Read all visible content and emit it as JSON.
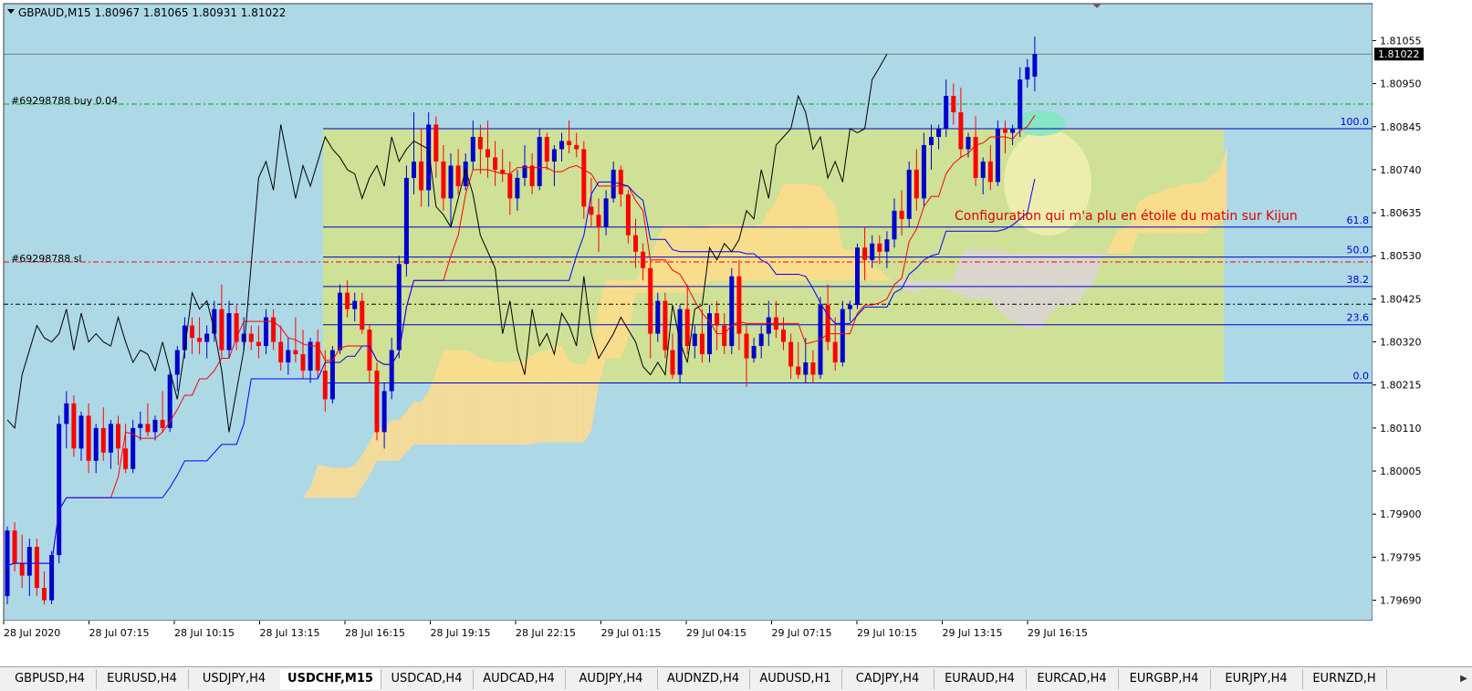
{
  "header": {
    "title": "GBPAUD,M15  1.80967 1.81065 1.80931 1.81022"
  },
  "order_labels": {
    "buy": "#69298788 buy 0.04",
    "sl": "#69298788 sl"
  },
  "annotation": "Configuration qui m'a plu en étoile du matin sur Kijun",
  "fibonacci": [
    {
      "label": "100.0",
      "price": 1.8084
    },
    {
      "label": "61.8",
      "price": 1.806
    },
    {
      "label": "50.0",
      "price": 1.80527
    },
    {
      "label": "38.2",
      "price": 1.80455
    },
    {
      "label": "23.6",
      "price": 1.80362
    },
    {
      "label": "0.0",
      "price": 1.8022
    }
  ],
  "colors": {
    "background": "#add8e6",
    "bull_candle": "#0000cd",
    "bear_candle": "#ff0000",
    "fib_line": "#0000cd",
    "fib_zone": "#d1e28d",
    "kumo_bull": "#ffdc8c",
    "kumo_bear": "#dcd2d7",
    "tenkan": "#ff0000",
    "kijun": "#0000ff",
    "chikou": "#000000",
    "cloud_cyan": "#9cdcf0",
    "highlight_green": "#80e8c0",
    "order_buy_line": "#00aa00",
    "order_sl_line": "#ff0000",
    "annotation_text": "#e00000"
  },
  "chart_data": {
    "type": "candlestick",
    "symbol": "GBPAUD",
    "timeframe": "M15",
    "ohlc": {
      "open": 1.80967,
      "high": 1.81065,
      "low": 1.80931,
      "close": 1.81022
    },
    "current_price_label": "1.81022",
    "current_price": 1.81022,
    "y_range": [
      1.7964,
      1.81145
    ],
    "y_ticks": [
      "1.81055",
      "1.80950",
      "1.80845",
      "1.80740",
      "1.80635",
      "1.80530",
      "1.80425",
      "1.80320",
      "1.80215",
      "1.80110",
      "1.80005",
      "1.79900",
      "1.79795",
      "1.79690"
    ],
    "x_ticks": [
      "28 Jul 2020",
      "28 Jul 07:15",
      "28 Jul 10:15",
      "28 Jul 13:15",
      "28 Jul 16:15",
      "28 Jul 19:15",
      "28 Jul 22:15",
      "29 Jul 01:15",
      "29 Jul 04:15",
      "29 Jul 07:15",
      "29 Jul 10:15",
      "29 Jul 13:15",
      "29 Jul 16:15"
    ],
    "order_lines": [
      {
        "name": "buy",
        "price": 1.809
      },
      {
        "name": "sl",
        "price": 1.80515
      }
    ],
    "bid_line": 1.80412,
    "candles": [
      [
        1.797,
        1.7987,
        1.7968,
        1.7986
      ],
      [
        1.7986,
        1.7988,
        1.7976,
        1.7978
      ],
      [
        1.7978,
        1.7985,
        1.7972,
        1.7975
      ],
      [
        1.7975,
        1.7984,
        1.797,
        1.7982
      ],
      [
        1.7982,
        1.7984,
        1.797,
        1.7972
      ],
      [
        1.7972,
        1.7976,
        1.7968,
        1.7969
      ],
      [
        1.7969,
        1.7981,
        1.7968,
        1.798
      ],
      [
        1.798,
        1.8014,
        1.7978,
        1.8012
      ],
      [
        1.8012,
        1.802,
        1.8006,
        1.8017
      ],
      [
        1.8017,
        1.8019,
        1.8004,
        1.8006
      ],
      [
        1.8006,
        1.8015,
        1.8003,
        1.8014
      ],
      [
        1.8014,
        1.8017,
        1.8,
        1.8003
      ],
      [
        1.8003,
        1.8012,
        1.8,
        1.8011
      ],
      [
        1.8011,
        1.8016,
        1.8003,
        1.8005
      ],
      [
        1.8005,
        1.8013,
        1.8001,
        1.8012
      ],
      [
        1.8012,
        1.8014,
        1.8002,
        1.8006
      ],
      [
        1.8006,
        1.8012,
        1.8,
        1.8001
      ],
      [
        1.8001,
        1.8013,
        1.8,
        1.8011
      ],
      [
        1.8011,
        1.8015,
        1.8008,
        1.8012
      ],
      [
        1.8012,
        1.8017,
        1.8009,
        1.801
      ],
      [
        1.801,
        1.8014,
        1.8008,
        1.8013
      ],
      [
        1.8013,
        1.802,
        1.801,
        1.8011
      ],
      [
        1.8011,
        1.8025,
        1.801,
        1.8024
      ],
      [
        1.8024,
        1.8031,
        1.802,
        1.803
      ],
      [
        1.803,
        1.8038,
        1.8028,
        1.8036
      ],
      [
        1.8036,
        1.8038,
        1.8029,
        1.8033
      ],
      [
        1.8033,
        1.8038,
        1.8029,
        1.8032
      ],
      [
        1.8032,
        1.8036,
        1.8028,
        1.8034
      ],
      [
        1.8034,
        1.8042,
        1.8032,
        1.804
      ],
      [
        1.804,
        1.8046,
        1.8028,
        1.803
      ],
      [
        1.803,
        1.8042,
        1.8028,
        1.8039
      ],
      [
        1.8039,
        1.8041,
        1.803,
        1.8032
      ],
      [
        1.8032,
        1.8038,
        1.803,
        1.8034
      ],
      [
        1.8034,
        1.8036,
        1.803,
        1.8032
      ],
      [
        1.8032,
        1.8036,
        1.8028,
        1.8031
      ],
      [
        1.8031,
        1.804,
        1.8029,
        1.8038
      ],
      [
        1.8038,
        1.804,
        1.803,
        1.8032
      ],
      [
        1.8032,
        1.8036,
        1.8025,
        1.8027
      ],
      [
        1.8027,
        1.8033,
        1.8024,
        1.803
      ],
      [
        1.803,
        1.8038,
        1.8027,
        1.8029
      ],
      [
        1.8029,
        1.8035,
        1.8023,
        1.8025
      ],
      [
        1.8025,
        1.8033,
        1.8022,
        1.8032
      ],
      [
        1.8032,
        1.8035,
        1.8023,
        1.8025
      ],
      [
        1.8025,
        1.803,
        1.8015,
        1.8018
      ],
      [
        1.8018,
        1.8031,
        1.8017,
        1.803
      ],
      [
        1.803,
        1.8046,
        1.8029,
        1.8044
      ],
      [
        1.8044,
        1.8047,
        1.8038,
        1.804
      ],
      [
        1.804,
        1.8044,
        1.8037,
        1.8042
      ],
      [
        1.8042,
        1.8044,
        1.8034,
        1.8035
      ],
      [
        1.8035,
        1.8036,
        1.8022,
        1.8025
      ],
      [
        1.8025,
        1.8027,
        1.8008,
        1.801
      ],
      [
        1.801,
        1.8022,
        1.8006,
        1.802
      ],
      [
        1.802,
        1.8033,
        1.8018,
        1.803
      ],
      [
        1.803,
        1.8053,
        1.8028,
        1.8051
      ],
      [
        1.8051,
        1.8075,
        1.8048,
        1.8072
      ],
      [
        1.8072,
        1.8088,
        1.8068,
        1.8076
      ],
      [
        1.8076,
        1.8084,
        1.8065,
        1.8069
      ],
      [
        1.8069,
        1.8088,
        1.8065,
        1.8085
      ],
      [
        1.8085,
        1.8087,
        1.8072,
        1.8076
      ],
      [
        1.8076,
        1.808,
        1.8064,
        1.8067
      ],
      [
        1.8067,
        1.8078,
        1.806,
        1.8075
      ],
      [
        1.8075,
        1.8079,
        1.8068,
        1.807
      ],
      [
        1.807,
        1.8078,
        1.8069,
        1.8076
      ],
      [
        1.8076,
        1.8086,
        1.8074,
        1.8082
      ],
      [
        1.8082,
        1.8085,
        1.8073,
        1.8079
      ],
      [
        1.8079,
        1.8086,
        1.8072,
        1.8077
      ],
      [
        1.8077,
        1.8081,
        1.807,
        1.8074
      ],
      [
        1.8074,
        1.8079,
        1.8071,
        1.8073
      ],
      [
        1.8073,
        1.8076,
        1.8063,
        1.8067
      ],
      [
        1.8067,
        1.8074,
        1.8064,
        1.8072
      ],
      [
        1.8072,
        1.808,
        1.807,
        1.8075
      ],
      [
        1.8075,
        1.8078,
        1.8068,
        1.807
      ],
      [
        1.807,
        1.8084,
        1.8069,
        1.8082
      ],
      [
        1.8082,
        1.8083,
        1.8074,
        1.8076
      ],
      [
        1.8076,
        1.808,
        1.807,
        1.8079
      ],
      [
        1.8079,
        1.8083,
        1.8076,
        1.8081
      ],
      [
        1.8081,
        1.8086,
        1.8078,
        1.808
      ],
      [
        1.808,
        1.8083,
        1.8077,
        1.8079
      ],
      [
        1.8079,
        1.8081,
        1.8062,
        1.8065
      ],
      [
        1.8065,
        1.8072,
        1.806,
        1.8063
      ],
      [
        1.8063,
        1.8067,
        1.8054,
        1.806
      ],
      [
        1.806,
        1.8069,
        1.8058,
        1.8067
      ],
      [
        1.8067,
        1.8076,
        1.8066,
        1.8074
      ],
      [
        1.8074,
        1.8075,
        1.8065,
        1.8068
      ],
      [
        1.8068,
        1.8069,
        1.8056,
        1.8058
      ],
      [
        1.8058,
        1.8062,
        1.805,
        1.8054
      ],
      [
        1.8054,
        1.8056,
        1.8047,
        1.805
      ],
      [
        1.805,
        1.8052,
        1.8028,
        1.8034
      ],
      [
        1.8034,
        1.8044,
        1.8032,
        1.8042
      ],
      [
        1.8042,
        1.8044,
        1.8028,
        1.803
      ],
      [
        1.803,
        1.8034,
        1.8023,
        1.8024
      ],
      [
        1.8024,
        1.8041,
        1.8022,
        1.804
      ],
      [
        1.804,
        1.8046,
        1.8029,
        1.8031
      ],
      [
        1.8031,
        1.8036,
        1.8028,
        1.8034
      ],
      [
        1.8034,
        1.804,
        1.8027,
        1.8029
      ],
      [
        1.8029,
        1.8041,
        1.8027,
        1.8039
      ],
      [
        1.8039,
        1.8042,
        1.803,
        1.8036
      ],
      [
        1.8036,
        1.8039,
        1.8029,
        1.8031
      ],
      [
        1.8031,
        1.805,
        1.8029,
        1.8048
      ],
      [
        1.8048,
        1.8052,
        1.803,
        1.8034
      ],
      [
        1.8034,
        1.8036,
        1.8021,
        1.8028
      ],
      [
        1.8028,
        1.8033,
        1.8027,
        1.8031
      ],
      [
        1.8031,
        1.8036,
        1.8028,
        1.8034
      ],
      [
        1.8034,
        1.8042,
        1.8031,
        1.8038
      ],
      [
        1.8038,
        1.8042,
        1.8033,
        1.8035
      ],
      [
        1.8035,
        1.8038,
        1.803,
        1.8032
      ],
      [
        1.8032,
        1.8034,
        1.8023,
        1.8026
      ],
      [
        1.8026,
        1.8032,
        1.8023,
        1.8024
      ],
      [
        1.8024,
        1.8033,
        1.8022,
        1.8027
      ],
      [
        1.8027,
        1.803,
        1.8022,
        1.8024
      ],
      [
        1.8024,
        1.8043,
        1.8023,
        1.8041
      ],
      [
        1.8041,
        1.8046,
        1.803,
        1.8032
      ],
      [
        1.8032,
        1.8038,
        1.8025,
        1.8027
      ],
      [
        1.8027,
        1.8042,
        1.8026,
        1.804
      ],
      [
        1.804,
        1.8042,
        1.8037,
        1.8041
      ],
      [
        1.8041,
        1.8056,
        1.804,
        1.8055
      ],
      [
        1.8055,
        1.806,
        1.8047,
        1.8052
      ],
      [
        1.8052,
        1.8058,
        1.805,
        1.8056
      ],
      [
        1.8056,
        1.8058,
        1.8051,
        1.8054
      ],
      [
        1.8054,
        1.8059,
        1.805,
        1.8057
      ],
      [
        1.8057,
        1.8067,
        1.8055,
        1.8064
      ],
      [
        1.8064,
        1.8069,
        1.8058,
        1.8062
      ],
      [
        1.8062,
        1.8076,
        1.806,
        1.8074
      ],
      [
        1.8074,
        1.8079,
        1.8064,
        1.8067
      ],
      [
        1.8067,
        1.8083,
        1.8065,
        1.808
      ],
      [
        1.808,
        1.8085,
        1.8074,
        1.8082
      ],
      [
        1.8082,
        1.8085,
        1.8079,
        1.8084
      ],
      [
        1.8084,
        1.8096,
        1.8082,
        1.8092
      ],
      [
        1.8092,
        1.8095,
        1.8085,
        1.8088
      ],
      [
        1.8088,
        1.8094,
        1.8077,
        1.8079
      ],
      [
        1.8079,
        1.8083,
        1.8077,
        1.8082
      ],
      [
        1.8082,
        1.8087,
        1.807,
        1.8072
      ],
      [
        1.8072,
        1.8077,
        1.8068,
        1.8076
      ],
      [
        1.8076,
        1.808,
        1.8069,
        1.8071
      ],
      [
        1.8071,
        1.8086,
        1.807,
        1.8084
      ],
      [
        1.8084,
        1.8086,
        1.8078,
        1.8083
      ],
      [
        1.8083,
        1.8085,
        1.808,
        1.8084
      ],
      [
        1.8084,
        1.8099,
        1.8082,
        1.8096
      ],
      [
        1.8096,
        1.8101,
        1.8094,
        1.8099
      ],
      [
        1.80967,
        1.81065,
        1.80931,
        1.81022
      ]
    ]
  },
  "tabs": [
    "GBPUSD,H4",
    "EURUSD,H4",
    "USDJPY,H4",
    "USDCHF,M15",
    "USDCAD,H4",
    "AUDCAD,H4",
    "AUDJPY,H4",
    "AUDNZD,H4",
    "AUDUSD,H1",
    "CADJPY,H4",
    "EURAUD,H4",
    "EURCAD,H4",
    "EURGBP,H4",
    "EURJPY,H4",
    "EURNZD,H"
  ],
  "active_tab": "USDCHF,M15"
}
